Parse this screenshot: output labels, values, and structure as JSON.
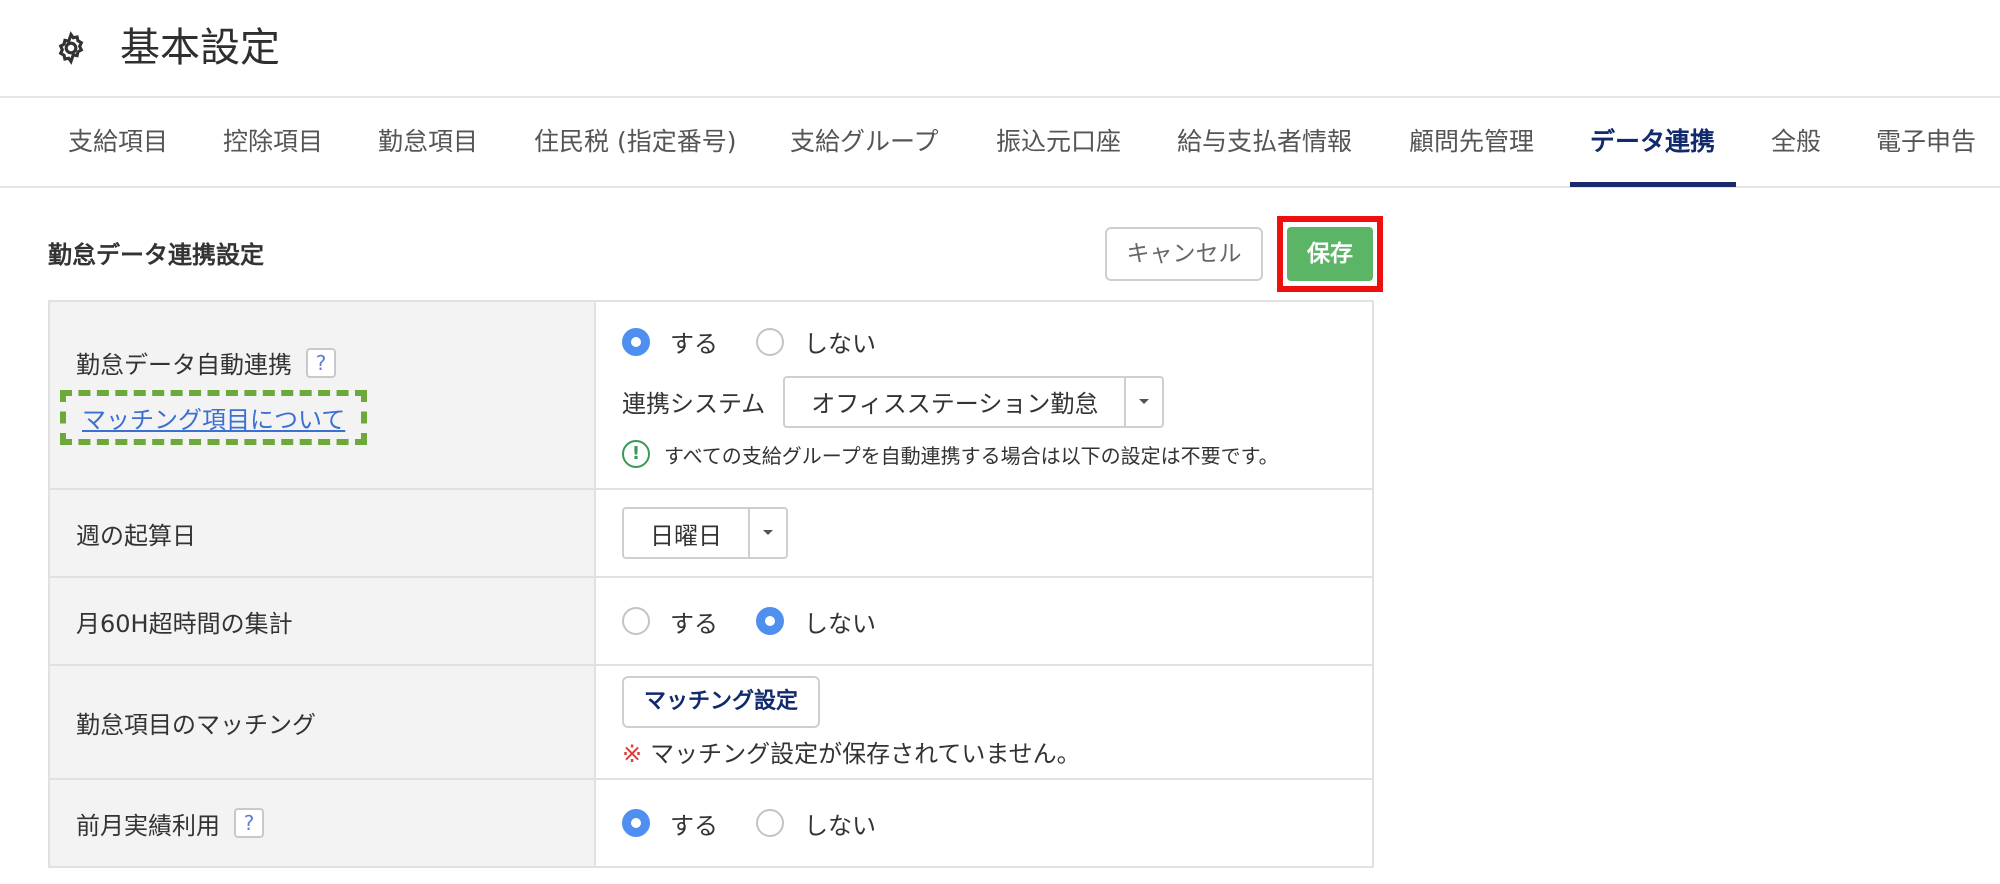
{
  "header": {
    "title": "基本設定",
    "icon": "gear-icon"
  },
  "tabs": [
    {
      "label": "支給項目"
    },
    {
      "label": "控除項目"
    },
    {
      "label": "勤怠項目"
    },
    {
      "label": "住民税 (指定番号)"
    },
    {
      "label": "支給グループ"
    },
    {
      "label": "振込元口座"
    },
    {
      "label": "給与支払者情報"
    },
    {
      "label": "顧問先管理"
    },
    {
      "label": "データ連携",
      "active": true
    },
    {
      "label": "全般"
    },
    {
      "label": "電子申告"
    }
  ],
  "section": {
    "title": "勤怠データ連携設定",
    "cancel_label": "キャンセル",
    "save_label": "保存"
  },
  "rows": {
    "auto_link": {
      "label": "勤怠データ自動連携",
      "help": "?",
      "link": "マッチング項目について",
      "option_yes": "する",
      "option_no": "しない",
      "selected": "する",
      "system_label": "連携システム",
      "system_value": "オフィスステーション勤怠",
      "notice": "すべての支給グループを自動連携する場合は以下の設定は不要です。",
      "notice_icon": "!"
    },
    "week_start": {
      "label": "週の起算日",
      "value": "日曜日"
    },
    "over60": {
      "label": "月60H超時間の集計",
      "option_yes": "する",
      "option_no": "しない",
      "selected": "しない"
    },
    "matching": {
      "label": "勤怠項目のマッチング",
      "button": "マッチング設定",
      "warn_mark": "※",
      "warning": "マッチング設定が保存されていません。"
    },
    "prev_month": {
      "label": "前月実績利用",
      "help": "?",
      "option_yes": "する",
      "option_no": "しない",
      "selected": "する"
    }
  },
  "colors": {
    "accent": "#1a2a6c",
    "save": "#5cb467",
    "radio": "#4f8ff0",
    "highlight_red": "#ee0f0f",
    "highlight_green": "#6ca83a"
  }
}
